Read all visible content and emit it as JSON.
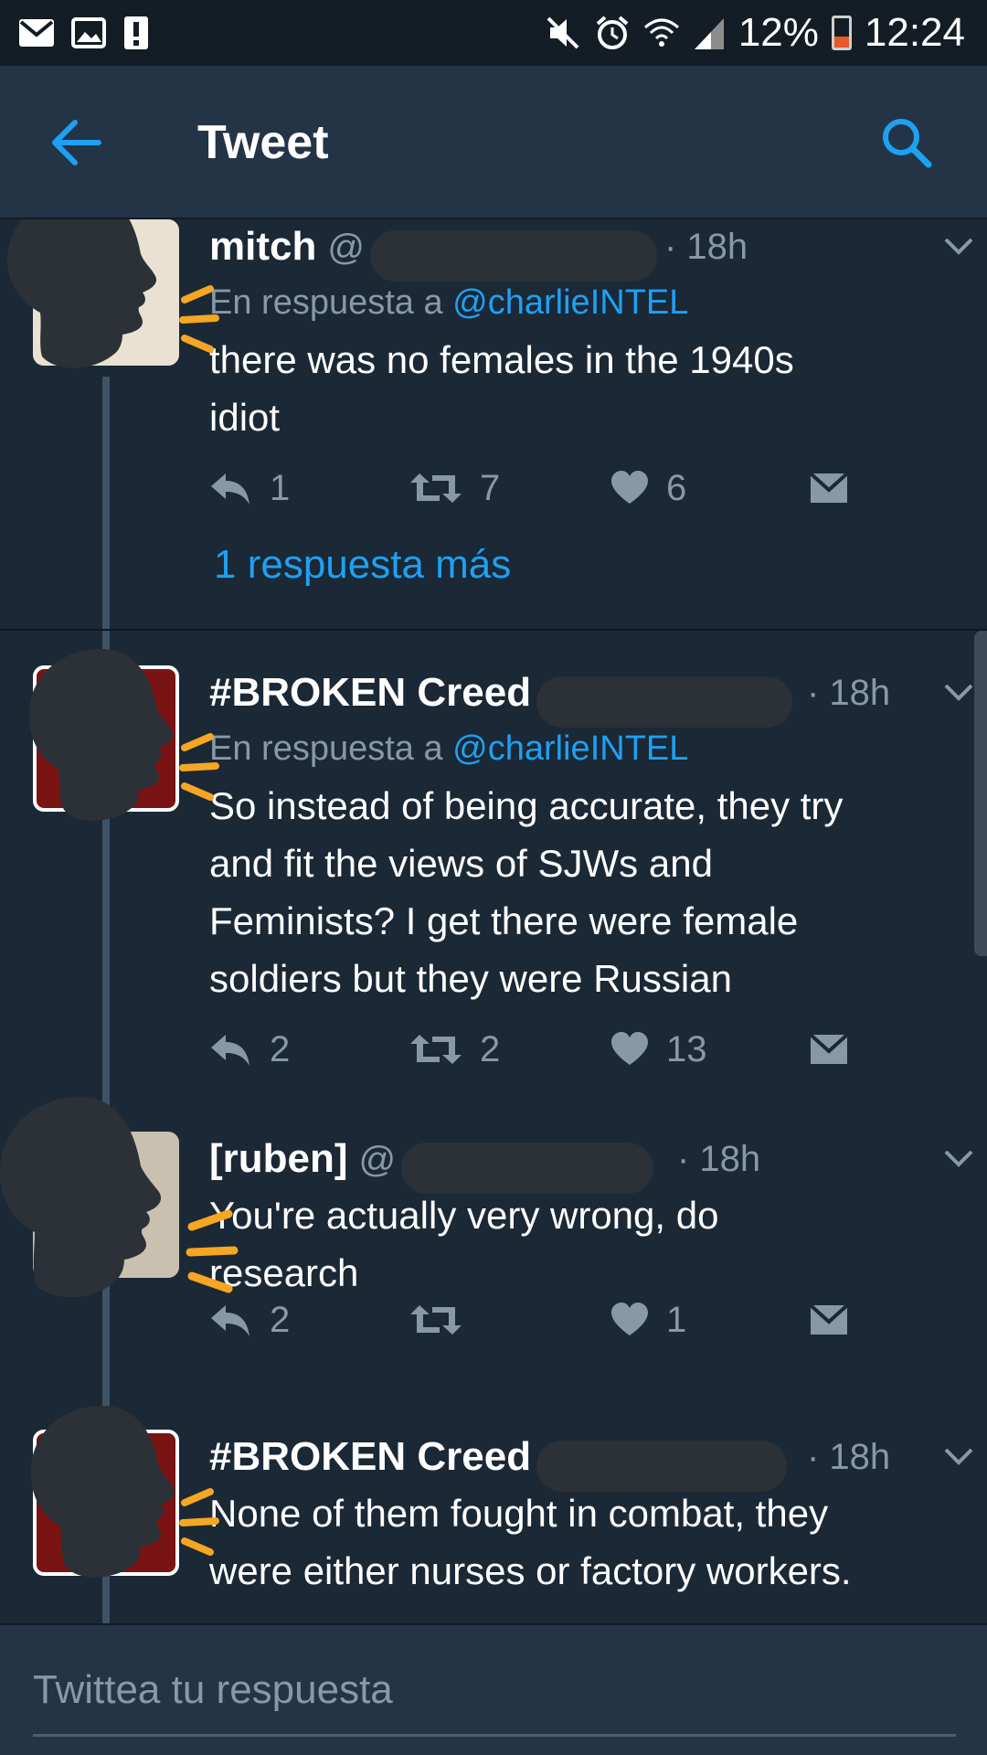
{
  "status_bar": {
    "battery": "12%",
    "time": "12:24"
  },
  "header": {
    "title": "Tweet"
  },
  "tweets": [
    {
      "name": "mitch",
      "handle": "@",
      "time": "· 18h",
      "reply_prefix": "En respuesta a",
      "reply_to": "@charlieINTEL",
      "text_lines": [
        "there was no females in the 1940s",
        "idiot"
      ],
      "replies": "1",
      "retweets": "7",
      "likes": "6"
    },
    {
      "name": "#BROKEN Creed",
      "handle": "",
      "time": "· 18h",
      "reply_prefix": "En respuesta a",
      "reply_to": "@charlieINTEL",
      "text_lines": [
        "So instead of being accurate, they try",
        "and fit the views of SJWs and",
        "Feminists? I get there were female",
        "soldiers but they were Russian"
      ],
      "replies": "2",
      "retweets": "2",
      "likes": "13"
    },
    {
      "name": "[ruben]",
      "handle": "@",
      "time": "· 18h",
      "text_lines": [
        "You're actually very wrong, do",
        "research"
      ],
      "replies": "2",
      "retweets": "",
      "likes": "1"
    },
    {
      "name": "#BROKEN Creed",
      "handle": "",
      "time": "· 18h",
      "text_lines": [
        "None of them fought in combat, they",
        "were either nurses or factory workers."
      ]
    }
  ],
  "more_replies_link": "1 respuesta más",
  "compose": {
    "placeholder": "Twittea tu respuesta"
  },
  "colors": {
    "background": "#1b2836",
    "bar": "#243447",
    "accent": "#1da1f2",
    "muted": "#8899a6",
    "scribble": "#f5a623"
  }
}
